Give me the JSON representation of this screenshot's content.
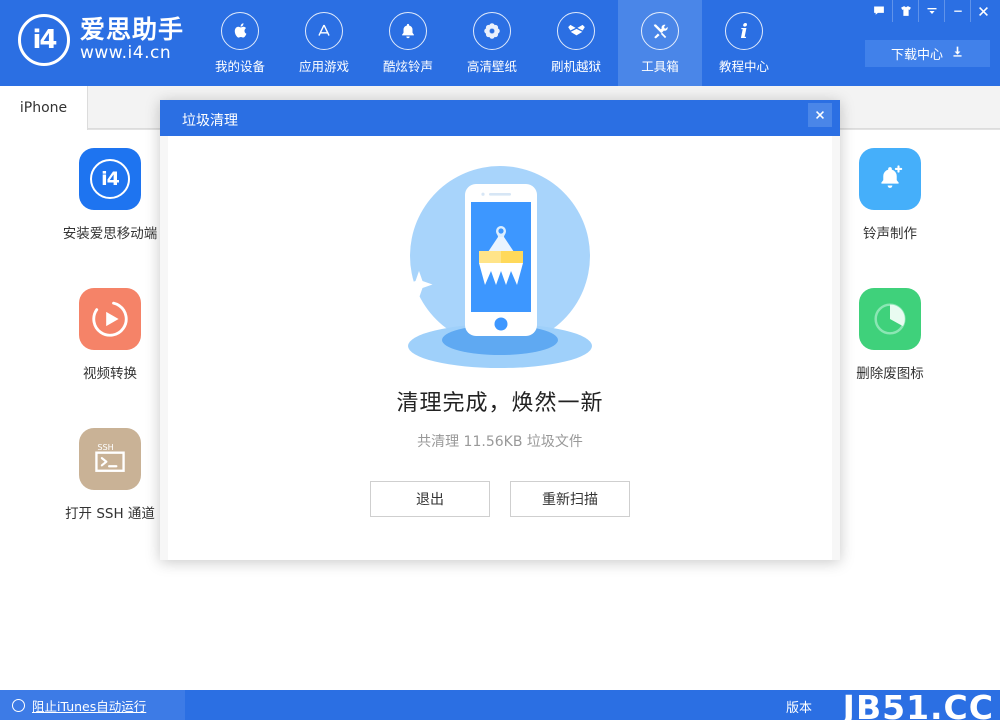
{
  "app": {
    "logo_mark": "i4",
    "logo_name": "爱思助手",
    "logo_url": "www.i4.cn"
  },
  "header": {
    "background_color": "#2B6FE3",
    "active_color": "#4A86E8",
    "nav": [
      {
        "label": "我的设备",
        "icon": "apple-icon",
        "active": false
      },
      {
        "label": "应用游戏",
        "icon": "appstore-icon",
        "active": false
      },
      {
        "label": "酷炫铃声",
        "icon": "bell-icon",
        "active": false
      },
      {
        "label": "高清壁纸",
        "icon": "flower-icon",
        "active": false
      },
      {
        "label": "刷机越狱",
        "icon": "box-icon",
        "active": false
      },
      {
        "label": "工具箱",
        "icon": "tools-icon",
        "active": true
      },
      {
        "label": "教程中心",
        "icon": "info-icon",
        "active": false
      }
    ],
    "window_buttons": [
      {
        "name": "feedback-icon",
        "glyph": "▭"
      },
      {
        "name": "skin-icon",
        "glyph": "T"
      },
      {
        "name": "menu-icon",
        "glyph": "▼"
      },
      {
        "name": "minimize-icon",
        "glyph": "–"
      },
      {
        "name": "close-icon",
        "glyph": "✕"
      }
    ],
    "download_center": {
      "label": "下载中心",
      "icon": "download-icon"
    }
  },
  "tabs": {
    "items": [
      {
        "label": "iPhone",
        "active": true
      }
    ]
  },
  "tools": {
    "left": [
      {
        "label": "安装爱思移动端",
        "icon": "i4-app-icon",
        "color": "#1E74F0"
      },
      {
        "label": "视频转换",
        "icon": "play-icon",
        "color": "#F58368"
      },
      {
        "label": "打开 SSH 通道",
        "icon": "terminal-icon",
        "color": "#C9B296"
      }
    ],
    "right": [
      {
        "label": "铃声制作",
        "icon": "bell-plus-icon",
        "color": "#45AFFA"
      },
      {
        "label": "删除废图标",
        "icon": "pie-icon",
        "color": "#3FD17B"
      }
    ]
  },
  "dialog": {
    "title": "垃圾清理",
    "close_label": "✕",
    "heading": "清理完成，焕然一新",
    "subtext": "共清理 11.56KB 垃圾文件",
    "buttons": [
      {
        "label": "退出",
        "name": "exit-button"
      },
      {
        "label": "重新扫描",
        "name": "rescan-button"
      }
    ],
    "illustration": {
      "name": "phone-broom-illustration",
      "circle_color": "#A8D4FB",
      "screen_color": "#3D97FF",
      "brush_color": "#FFD95A"
    }
  },
  "statusbar": {
    "itunes_toggle_label": "阻止iTunes自动运行",
    "version_label": "版本",
    "watermark": "JB51.CC"
  }
}
